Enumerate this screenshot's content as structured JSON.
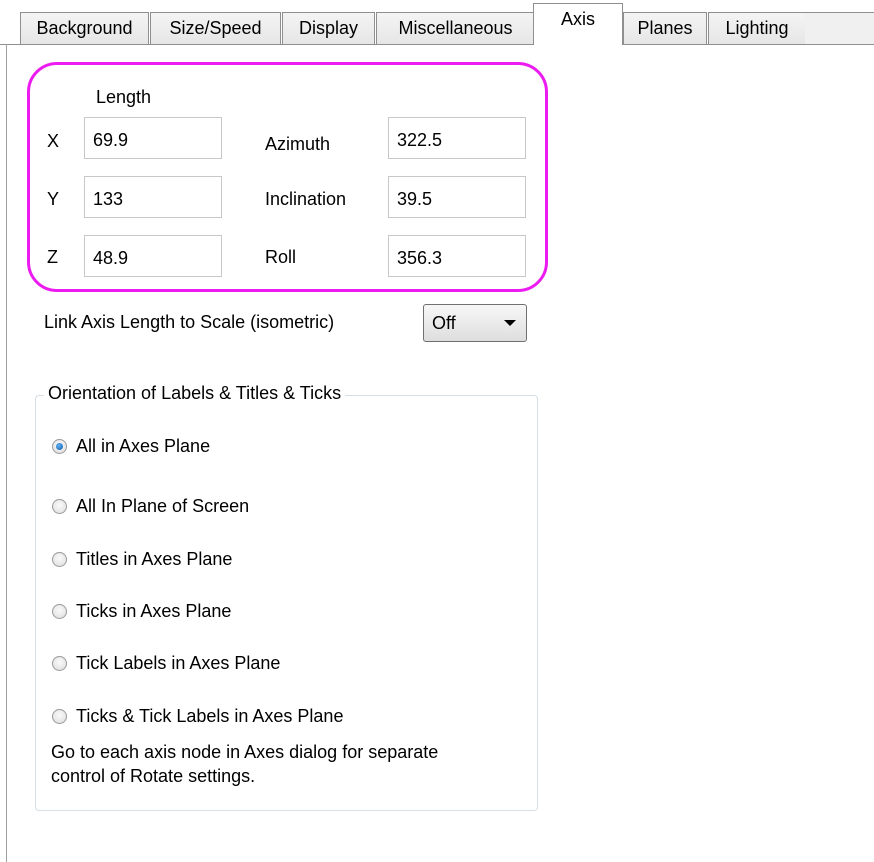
{
  "tabs": [
    {
      "label": "Background"
    },
    {
      "label": "Size/Speed"
    },
    {
      "label": "Display"
    },
    {
      "label": "Miscellaneous"
    },
    {
      "label": "Axis",
      "active": true
    },
    {
      "label": "Planes"
    },
    {
      "label": "Lighting"
    }
  ],
  "axis": {
    "length_header": "Length",
    "x_label": "X",
    "y_label": "Y",
    "z_label": "Z",
    "x_value": "69.9",
    "y_value": "133",
    "z_value": "48.9",
    "azimuth_label": "Azimuth",
    "inclination_label": "Inclination",
    "roll_label": "Roll",
    "azimuth_value": "322.5",
    "inclination_value": "39.5",
    "roll_value": "356.3",
    "highlight_color": "#ec1cf0"
  },
  "link": {
    "label": "Link Axis Length to Scale (isometric)",
    "value": "Off"
  },
  "orientation": {
    "title": "Orientation of Labels & Titles & Ticks",
    "options": [
      {
        "label": "All in Axes Plane",
        "checked": true
      },
      {
        "label": "All In Plane of Screen",
        "checked": false
      },
      {
        "label": "Titles in Axes Plane",
        "checked": false
      },
      {
        "label": "Ticks in Axes Plane",
        "checked": false
      },
      {
        "label": "Tick Labels in Axes Plane",
        "checked": false
      },
      {
        "label": "Ticks & Tick Labels in Axes Plane",
        "checked": false
      }
    ],
    "note_line1": "Go to each axis node in Axes dialog for separate",
    "note_line2": "control of Rotate settings."
  }
}
